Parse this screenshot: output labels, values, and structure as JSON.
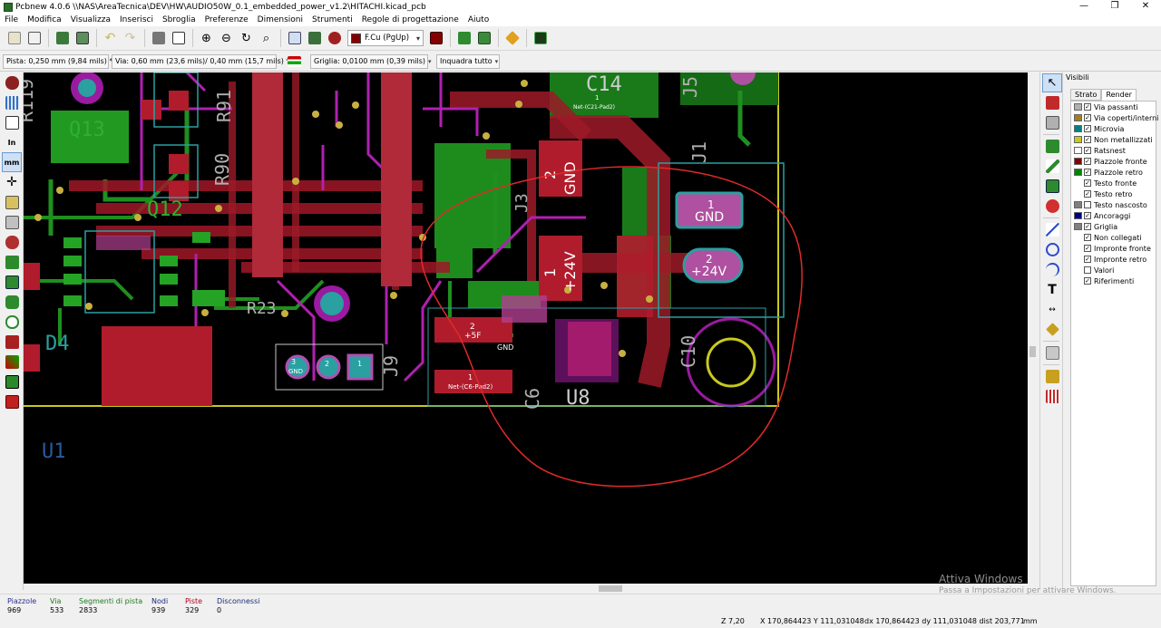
{
  "window": {
    "title": "Pcbnew 4.0.6 \\\\NAS\\AreaTecnica\\DEV\\HW\\AUDIO50W_0.1_embedded_power_v1.2\\HITACHI.kicad_pcb",
    "minimize": "—",
    "maximize": "❐",
    "close": "✕"
  },
  "menu": [
    "File",
    "Modifica",
    "Visualizza",
    "Inserisci",
    "Sbroglia",
    "Preferenze",
    "Dimensioni",
    "Strumenti",
    "Regole di progettazione",
    "Aiuto"
  ],
  "toolbar": {
    "icons": [
      "new-board-icon",
      "open-icon",
      "save-icon",
      "page-settings-icon",
      "undo-icon",
      "redo-icon",
      "print-icon",
      "plot-icon",
      "zoom-in-icon",
      "zoom-out-icon",
      "zoom-redraw-icon",
      "zoom-fit-icon",
      "find-icon",
      "netlist-icon",
      "drc-bug-icon"
    ],
    "active_layer": "F.Cu (PgUp)",
    "layer_color": "#840000",
    "icons2": [
      "layer-pair-icon",
      "grid-route-icon",
      "autoplace-icon",
      "drc-warning-icon",
      "scripting-icon"
    ]
  },
  "options": {
    "track": "Pista: 0,250 mm (9,84 mils) *",
    "via": "Via: 0,60 mm (23,6 mils)/ 0,40 mm (15,7 mils) *",
    "grid": "Griglia: 0,0100 mm (0,39 mils)",
    "zoom": "Inquadra tutto"
  },
  "left_toolbar": [
    "drc-icon",
    "grid-toggle-icon",
    "polar-coords-icon",
    "In",
    "mm",
    "cursor-shape-icon",
    "show-ratsnest-icon",
    "module-ratsnest-icon",
    "auto-route-icon",
    "zone-fill-icon",
    "zone-outline-icon",
    "via-sketch-icon",
    "pad-sketch-icon",
    "track-sketch-icon",
    "high-contrast-icon",
    "microwave-icon",
    "layers-manager-icon"
  ],
  "right_toolbar": [
    "select-arrow-icon",
    "highlight-net-icon",
    "local-ratsnest-icon",
    "add-footprint-icon",
    "route-track-icon",
    "add-zone-icon",
    "keepout-icon",
    "add-line-icon",
    "add-circle-icon",
    "add-arc-icon",
    "add-text-icon",
    "add-dimension-icon",
    "add-target-icon",
    "delete-icon",
    "set-origin-icon",
    "grid-origin-icon"
  ],
  "panel": {
    "title": "Visibili",
    "tabs": [
      "Strato",
      "Render"
    ],
    "active_tab": "Render",
    "items": [
      {
        "label": "Via passanti",
        "color": "#b0b0b0",
        "checked": true
      },
      {
        "label": "Via coperti/interni",
        "color": "#a08020",
        "checked": true
      },
      {
        "label": "Microvia",
        "color": "#008080",
        "checked": true
      },
      {
        "label": "Non metallizzati",
        "color": "#c8c820",
        "checked": true
      },
      {
        "label": "Ratsnest",
        "color": "#ffffff",
        "checked": true
      },
      {
        "label": "Piazzole fronte",
        "color": "#840000",
        "checked": true
      },
      {
        "label": "Piazzole retro",
        "color": "#008400",
        "checked": true
      },
      {
        "label": "Testo fronte",
        "color": "",
        "checked": true
      },
      {
        "label": "Testo retro",
        "color": "",
        "checked": true
      },
      {
        "label": "Testo nascosto",
        "color": "#808080",
        "checked": false
      },
      {
        "label": "Ancoraggi",
        "color": "#000084",
        "checked": true
      },
      {
        "label": "Griglia",
        "color": "#808080",
        "checked": true
      },
      {
        "label": "Non collegati",
        "color": "",
        "checked": true
      },
      {
        "label": "Impronte fronte",
        "color": "",
        "checked": true
      },
      {
        "label": "Impronte retro",
        "color": "",
        "checked": true
      },
      {
        "label": "Valori",
        "color": "",
        "checked": false
      },
      {
        "label": "Riferimenti",
        "color": "",
        "checked": true
      }
    ]
  },
  "board": {
    "refs": [
      "R119",
      "Q13",
      "R91",
      "R90",
      "Q12",
      "D4",
      "U1",
      "C14",
      "J5",
      "J1",
      "J3",
      "J9",
      "U8",
      "C6",
      "C10",
      "R23"
    ],
    "pad_labels": {
      "gnd_big": "GND",
      "v24_big": "+24V",
      "pin1": "1",
      "pin2": "2",
      "v5": "+5F",
      "net_c21": "Net-(C21-Pad2)",
      "net_c6": "Net-(C6-Pad2)",
      "gnd_small": "GND",
      "j9_gnd": "GND",
      "j9_3": "3",
      "j9_2": "2",
      "j9_1": "1"
    }
  },
  "status": {
    "piazzole_label": "Piazzole",
    "piazzole": "969",
    "via_label": "Via",
    "via": "533",
    "segmenti_label": "Segmenti di pista",
    "segmenti": "2833",
    "nodi_label": "Nodi",
    "nodi": "939",
    "piste_label": "Piste",
    "piste": "329",
    "disconnessi_label": "Disconnessi",
    "disconnessi": "0",
    "zoom": "Z 7,20",
    "xy": "X 170,864423  Y 111,031048",
    "dxdy": "dx 170,864423  dy 111,031048  dist 203,771",
    "units": "mm"
  },
  "watermark": {
    "line1": "Attiva Windows",
    "line2": "Passa a Impostazioni per attivare Windows."
  }
}
